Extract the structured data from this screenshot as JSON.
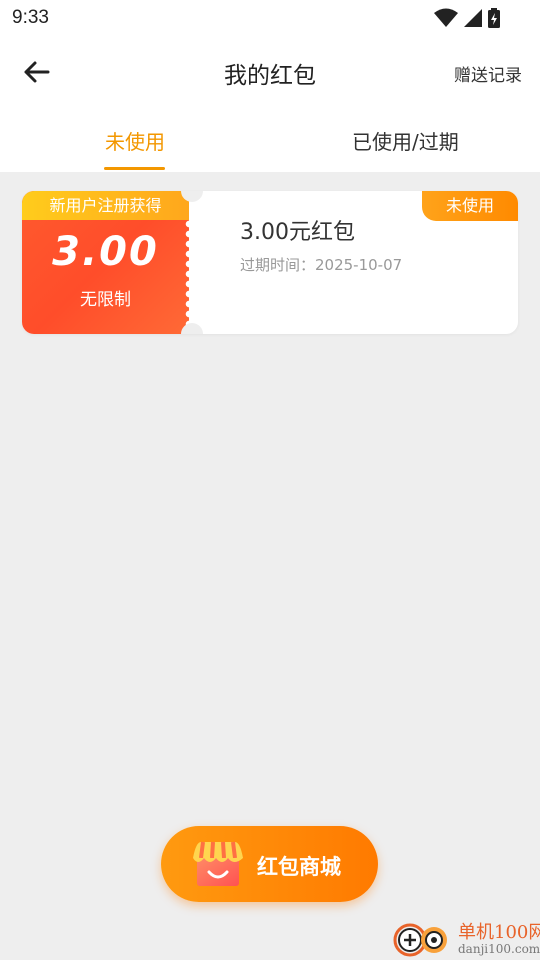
{
  "status_bar": {
    "time": "9:33"
  },
  "header": {
    "title": "我的红包",
    "action": "赠送记录"
  },
  "tabs": [
    {
      "label": "未使用",
      "active": true
    },
    {
      "label": "已使用/过期",
      "active": false
    }
  ],
  "coupon": {
    "source": "新用户注册获得",
    "amount": "3.00",
    "limit": "无限制",
    "name": "3.00元红包",
    "expiry": "过期时间：2025-10-07",
    "badge": "未使用"
  },
  "shop_button": {
    "label": "红包商城"
  },
  "watermark": {
    "title": "单机100网",
    "url": "danji100.com"
  },
  "colors": {
    "accent": "#f39700",
    "coupon_red": "#ff5a2e",
    "coupon_yellow": "#ffcc1c",
    "background": "#eeeeee"
  }
}
